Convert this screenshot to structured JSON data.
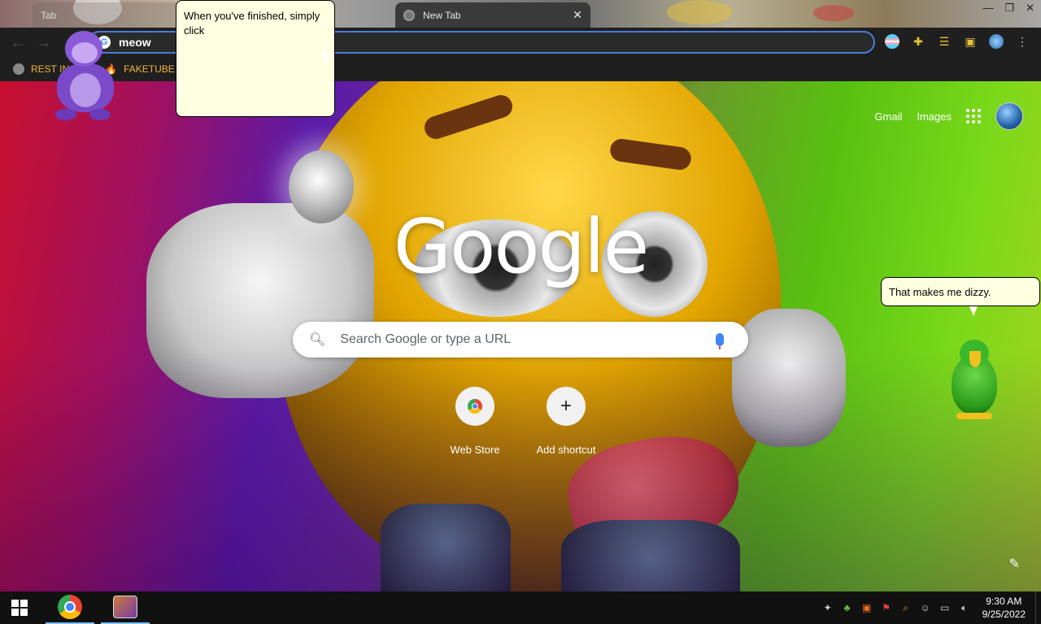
{
  "browser": {
    "tabs": [
      {
        "label": "Tab",
        "active": false
      },
      {
        "label": "New Tab",
        "active": true
      }
    ],
    "omnibox_value": "meow",
    "bookmarks": [
      {
        "label": "REST IN",
        "icon": "globe-icon"
      },
      {
        "label": "FAKETUBE",
        "icon": "fire-icon"
      }
    ]
  },
  "ntp": {
    "links": {
      "gmail": "Gmail",
      "images": "Images"
    },
    "logo": "Google",
    "search_placeholder": "Search Google or type a URL",
    "shortcuts": [
      {
        "label": "Web Store",
        "icon": "chrome-web-store-icon"
      },
      {
        "label": "Add shortcut",
        "icon": "plus-icon"
      }
    ]
  },
  "assistants": {
    "bonzi_balloon": "When you've finished, simply click",
    "parrot_balloon": "That makes me dizzy."
  },
  "taskbar": {
    "time": "9:30 AM",
    "date": "9/25/2022"
  },
  "colors": {
    "omnibox_border": "#4a7bd8",
    "bookmark_text": "#f0b43c",
    "balloon_bg": "#ffffe1",
    "taskbar_bg": "#111111"
  }
}
